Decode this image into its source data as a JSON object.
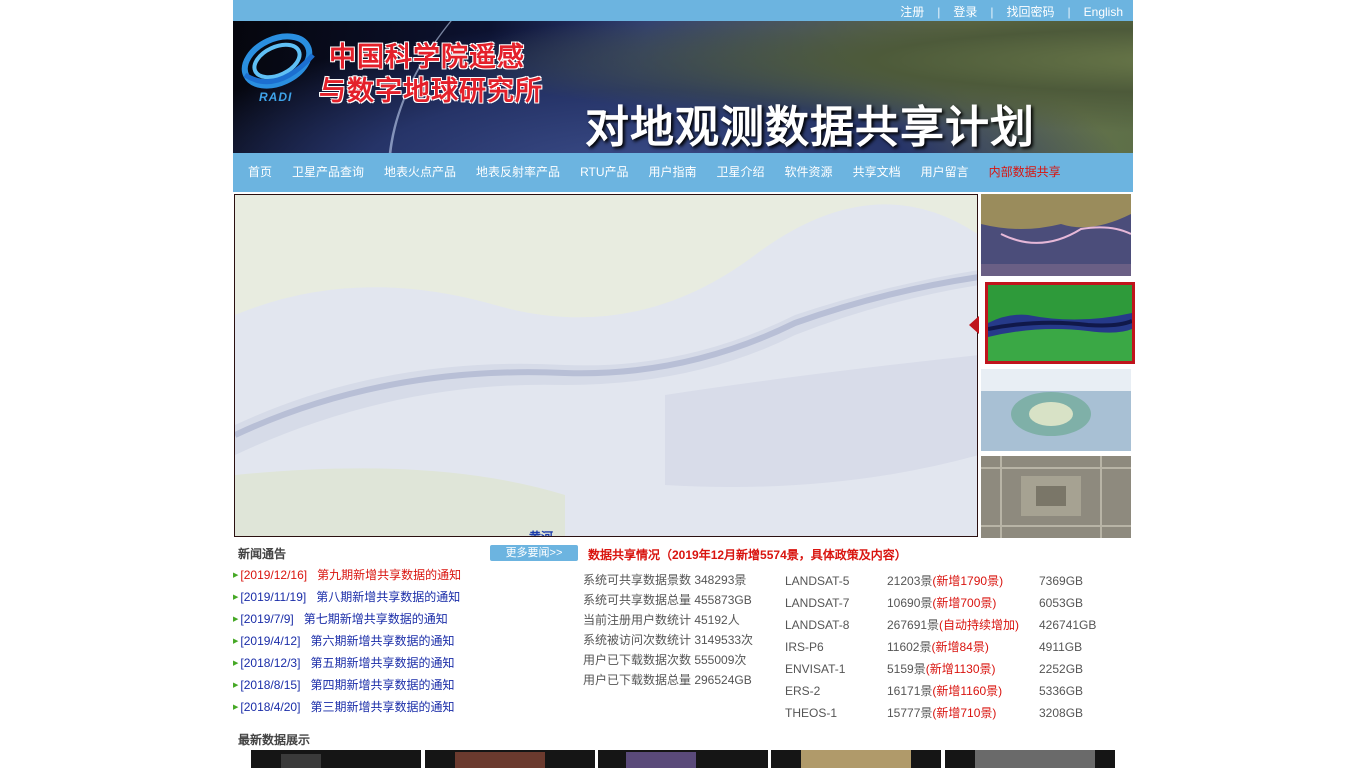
{
  "topbar": {
    "links": [
      "注册",
      "登录",
      "找回密码",
      "English"
    ],
    "separator": "|"
  },
  "banner": {
    "org_line1": "中国科学院遥感",
    "org_line2": "与数字地球研究所",
    "logo_text": "RADI",
    "title": "对地观测数据共享计划"
  },
  "nav": {
    "items": [
      "首页",
      "卫星产品查询",
      "地表火点产品",
      "地表反射率产品",
      "RTU产品",
      "用户指南",
      "卫星介绍",
      "软件资源",
      "共享文档",
      "用户留言",
      "内部数据共享"
    ]
  },
  "slider": {
    "caption": "黄河"
  },
  "news": {
    "title": "新闻通告",
    "more_label": "更多要闻>>",
    "items": [
      {
        "date": "[2019/12/16]",
        "title": "第九期新增共享数据的通知"
      },
      {
        "date": "[2019/11/19]",
        "title": "第八期新增共享数据的通知"
      },
      {
        "date": "[2019/7/9]",
        "title": "第七期新增共享数据的通知"
      },
      {
        "date": "[2019/4/12]",
        "title": "第六期新增共享数据的通知"
      },
      {
        "date": "[2018/12/3]",
        "title": "第五期新增共享数据的通知"
      },
      {
        "date": "[2018/8/15]",
        "title": "第四期新增共享数据的通知"
      },
      {
        "date": "[2018/4/20]",
        "title": "第三期新增共享数据的通知"
      }
    ]
  },
  "share": {
    "title": "数据共享情况（2019年12月新增5574景，具体政策及内容）",
    "stats": [
      "系统可共享数据景数 348293景",
      "系统可共享数据总量 455873GB",
      "当前注册用户数统计 45192人",
      "系统被访问次数统计 3149533次",
      "用户已下载数据次数 555009次",
      "用户已下载数据总量 296524GB"
    ],
    "satellites": [
      {
        "name": "LANDSAT-5",
        "count": "21203景",
        "new": "(新增1790景)",
        "size": "7369GB"
      },
      {
        "name": "LANDSAT-7",
        "count": "10690景",
        "new": "(新增700景)",
        "size": "6053GB"
      },
      {
        "name": "LANDSAT-8",
        "count": "267691景",
        "new": "(自动持续增加)",
        "size": "426741GB"
      },
      {
        "name": "IRS-P6",
        "count": "11602景",
        "new": "(新增84景)",
        "size": "4911GB"
      },
      {
        "name": "ENVISAT-1",
        "count": "5159景",
        "new": "(新增1130景)",
        "size": "2252GB"
      },
      {
        "name": "ERS-2",
        "count": "16171景",
        "new": "(新增1160景)",
        "size": "5336GB"
      },
      {
        "name": "THEOS-1",
        "count": "15777景",
        "new": "(新增710景)",
        "size": "3208GB"
      }
    ]
  },
  "latest": {
    "title": "最新数据展示"
  },
  "colors": {
    "nav_blue": "#6cb4e0",
    "news_red": "#d9140f",
    "news_blue": "#1a2da8"
  }
}
